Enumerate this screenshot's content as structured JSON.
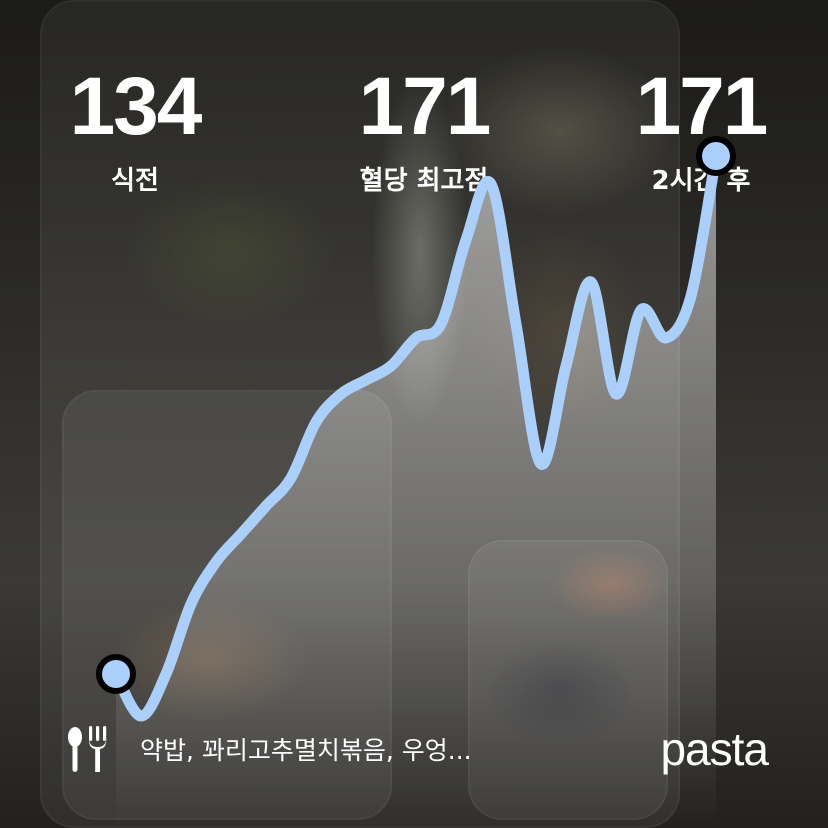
{
  "stats": [
    {
      "value": "134",
      "label": "식전"
    },
    {
      "value": "171",
      "label": "혈당 최고점"
    },
    {
      "value": "171",
      "label": "2시간 후"
    }
  ],
  "meal": {
    "icon": "fork-knife-icon",
    "text": "약밥, 꽈리고추멸치볶음, 우엉..."
  },
  "brand": "pasta",
  "colors": {
    "line": "#a9cffa",
    "text": "#ffffff",
    "marker_outline": "#000000"
  },
  "chart_data": {
    "type": "line",
    "title": "",
    "xlabel": "",
    "ylabel": "",
    "x": [
      0,
      5,
      10,
      15,
      20,
      25,
      30,
      35,
      40,
      45,
      50,
      55,
      60,
      65,
      70,
      75,
      80,
      85,
      90,
      95,
      100,
      105,
      110,
      115,
      120
    ],
    "series": [
      {
        "values": [
          134,
          131,
          134,
          139,
          142,
          144,
          146,
          148,
          152,
          154,
          155,
          156,
          158,
          159,
          165,
          169,
          159,
          149,
          156,
          162,
          154,
          160,
          158,
          161,
          171
        ]
      }
    ],
    "ylim": [
      125,
      175
    ],
    "grid": false,
    "legend": "none"
  }
}
